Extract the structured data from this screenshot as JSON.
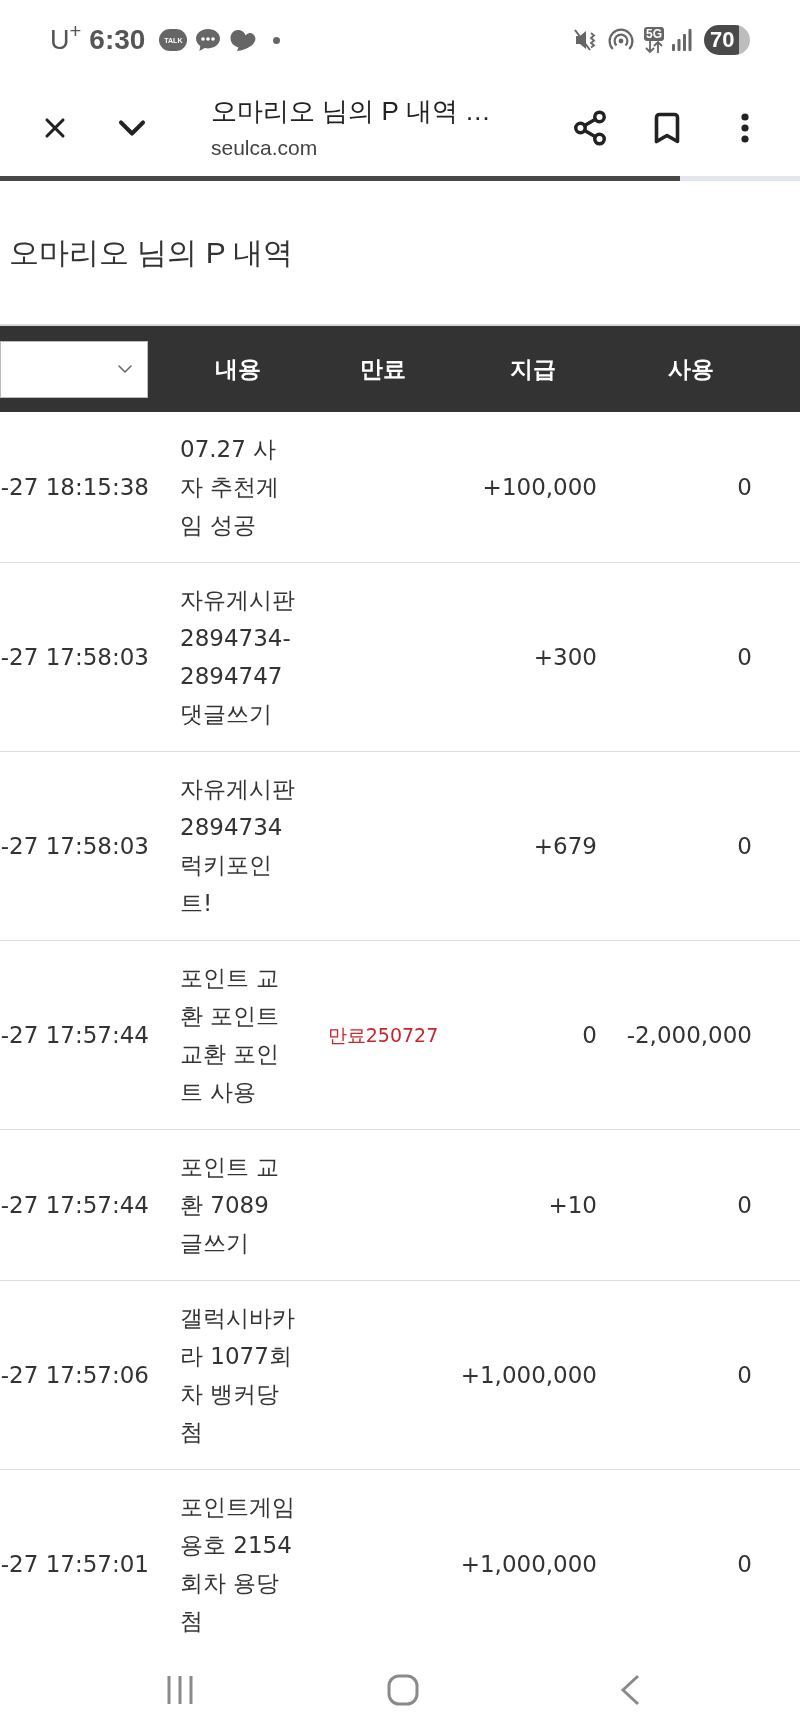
{
  "status_bar": {
    "carrier": "U$^{+}$",
    "time": "6:30",
    "talk_badge": "TALK",
    "network": "5G",
    "battery": "70"
  },
  "browser_bar": {
    "title": "오마리오 님의 P 내역 …",
    "url": "seulca.com",
    "load_progress": {
      "level": 0.85
    }
  },
  "page_title": "오마리오 님의 P 내역",
  "table": {
    "columns": [
      "내용",
      "만료",
      "지급",
      "사용"
    ],
    "rows": [
      {
        "datetime": "-27 18:15:38",
        "content": "07.27 사자 추천게임 성공",
        "paid": "+100,000",
        "used": "0"
      },
      {
        "datetime": "-27 17:58:03",
        "content": "자유게시판 2894734-2894747 댓글쓰기",
        "paid": "+300",
        "used": "0"
      },
      {
        "datetime": "-27 17:58:03",
        "content": "자유게시판 2894734 럭키포인트!",
        "paid": "+679",
        "used": "0"
      },
      {
        "datetime": "-27 17:57:44",
        "content": "포인트 교환 포인트 교환 포인트 사용",
        "expiry": "만료250727",
        "paid": "0",
        "used": "-2,000,000"
      },
      {
        "datetime": "-27 17:57:44",
        "content": "포인트 교환 7089 글쓰기",
        "paid": "+10",
        "used": "0"
      },
      {
        "datetime": "-27 17:57:06",
        "content": "갤럭시바카라 1077회차 뱅커당첨",
        "paid": "+1,000,000",
        "used": "0"
      },
      {
        "datetime": "-27 17:57:01",
        "content": "포인트게임 용호 2154회차 용당첨",
        "paid": "+1,000,000",
        "used": "0"
      }
    ]
  }
}
